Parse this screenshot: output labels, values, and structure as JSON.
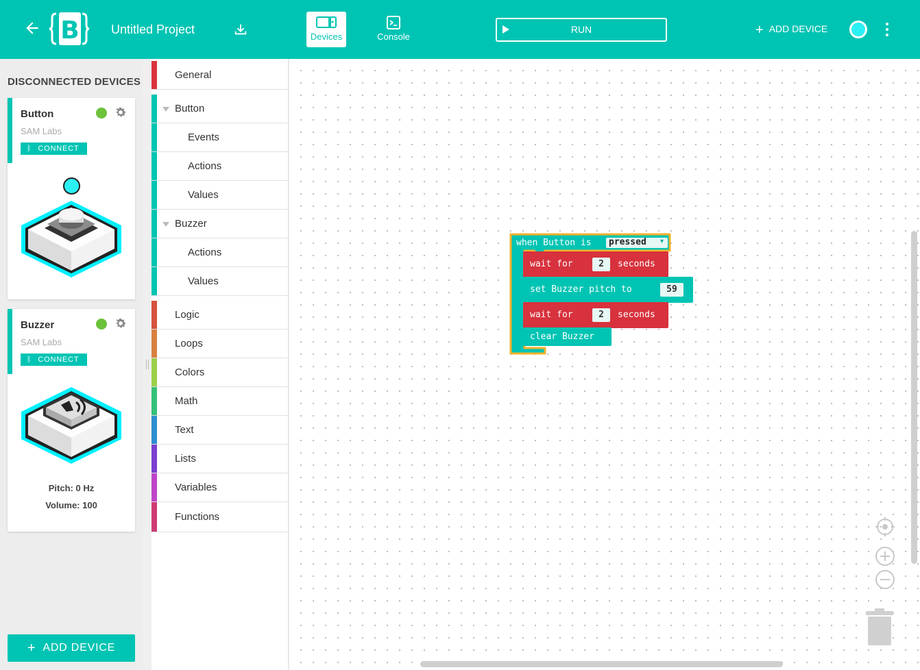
{
  "app": {
    "project_title": "Untitled Project",
    "tabs": [
      {
        "label": "Devices",
        "active": true
      },
      {
        "label": "Console",
        "active": false
      }
    ],
    "run_label": "RUN",
    "add_device_label": "ADD DEVICE",
    "status_color": "#2bf0f4",
    "accent_color": "#00c4b3"
  },
  "sidebar": {
    "heading": "DISCONNECTED DEVICES",
    "devices": [
      {
        "name": "Button",
        "maker": "SAM Labs",
        "connect_label": "CONNECT",
        "led_color": "#2bf0f4"
      },
      {
        "name": "Buzzer",
        "maker": "SAM Labs",
        "connect_label": "CONNECT",
        "pitch": "Pitch: 0 Hz",
        "volume": "Volume: 100"
      }
    ],
    "add_device_label": "ADD DEVICE"
  },
  "toolbox": {
    "categories": [
      {
        "label": "General",
        "color": "#d9343e"
      },
      {
        "label": "Button",
        "color": "#00c4b3",
        "expanded": true
      },
      {
        "label": "Events",
        "color": "#00c4b3"
      },
      {
        "label": "Actions",
        "color": "#00c4b3"
      },
      {
        "label": "Values",
        "color": "#00c4b3"
      },
      {
        "label": "Buzzer",
        "color": "#00c4b3",
        "expanded": true
      },
      {
        "label": "Actions",
        "color": "#00c4b3"
      },
      {
        "label": "Values",
        "color": "#00c4b3"
      },
      {
        "label": "Logic",
        "color": "#d5533c"
      },
      {
        "label": "Loops",
        "color": "#d9813f"
      },
      {
        "label": "Colors",
        "color": "#9bd04a"
      },
      {
        "label": "Math",
        "color": "#35c17a"
      },
      {
        "label": "Text",
        "color": "#2f8fd1"
      },
      {
        "label": "Lists",
        "color": "#7b3fcf"
      },
      {
        "label": "Variables",
        "color": "#bf44c9"
      },
      {
        "label": "Functions",
        "color": "#cf3a74"
      }
    ]
  },
  "blocks": {
    "event": {
      "prefix": "when Button is",
      "dropdown": "pressed"
    },
    "wait1": {
      "label": "wait for",
      "value": "2",
      "suffix": "seconds"
    },
    "set_pitch": {
      "label": "set Buzzer pitch to",
      "value": "59"
    },
    "wait2": {
      "label": "wait for",
      "value": "2",
      "suffix": "seconds"
    },
    "clear": {
      "label": "clear Buzzer"
    }
  }
}
